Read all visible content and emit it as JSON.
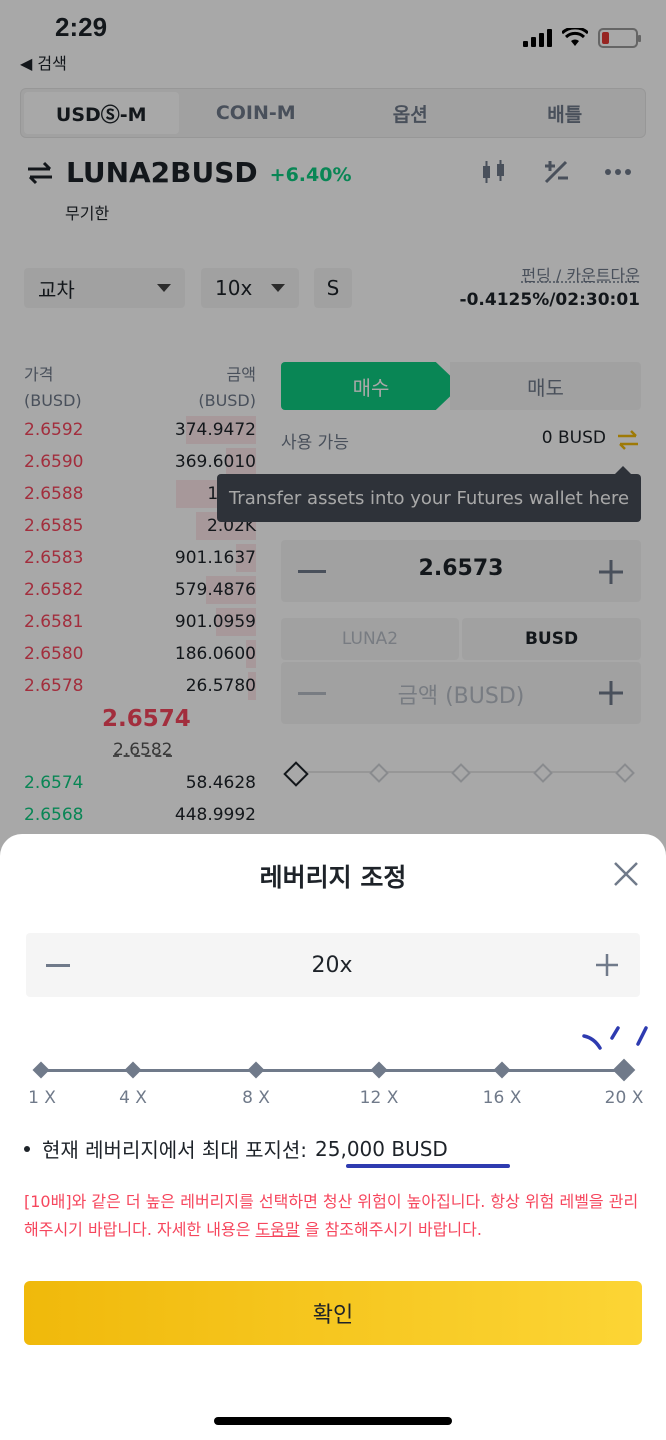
{
  "status_bar": {
    "time": "2:29",
    "back_label": "◀ 검색"
  },
  "tabs": [
    {
      "label": "USDⓈ-M",
      "active": true
    },
    {
      "label": "COIN-M"
    },
    {
      "label": "옵션"
    },
    {
      "label": "배틀"
    }
  ],
  "header": {
    "pair": "LUNA2BUSD",
    "change": "+6.40%",
    "subtitle": "무기한"
  },
  "controls": {
    "margin_mode": "교차",
    "leverage": "10x",
    "size_mode": "S",
    "funding_label": "펀딩 / 카운트다운",
    "funding_value": "-0.4125%/02:30:01"
  },
  "orderbook": {
    "price_header": "가격\n(BUSD)",
    "amount_header": "금액\n(BUSD)",
    "asks": [
      {
        "price": "2.6592",
        "amount": "374.9472"
      },
      {
        "price": "2.6590",
        "amount": "369.6010"
      },
      {
        "price": "2.6588",
        "amount": "122.3"
      },
      {
        "price": "2.6585",
        "amount": "2.02K"
      },
      {
        "price": "2.6583",
        "amount": "901.1637"
      },
      {
        "price": "2.6582",
        "amount": "579.4876"
      },
      {
        "price": "2.6581",
        "amount": "901.0959"
      },
      {
        "price": "2.6580",
        "amount": "186.0600"
      },
      {
        "price": "2.6578",
        "amount": "26.5780"
      }
    ],
    "mid_price": "2.6574",
    "mark_price": "2.6582",
    "bids": [
      {
        "price": "2.6574",
        "amount": "58.4628"
      },
      {
        "price": "2.6568",
        "amount": "448.9992"
      }
    ]
  },
  "order_form": {
    "buy_label": "매수",
    "sell_label": "매도",
    "available_label": "사용 가능",
    "available_value": "0 BUSD",
    "tooltip": "Transfer assets into your Futures wallet here",
    "price_value": "2.6573",
    "unit_luna": "LUNA2",
    "unit_busd": "BUSD",
    "amount_placeholder": "금액 (BUSD)"
  },
  "leverage_sheet": {
    "title": "레버리지 조정",
    "value": "20x",
    "ticks": [
      "1 X",
      "4 X",
      "8 X",
      "12 X",
      "16 X",
      "20 X"
    ],
    "selected_level": 20,
    "info_prefix": "현재 레버리지에서 최대 포지션:",
    "info_value": "25,000 BUSD",
    "warning_part1": "[10배]와 같은 더 높은 레버리지를 선택하면 청산 위험이 높아집니다. 항상 위험 레벨을 관리해주시기 바랍니다. 자세한 내용은 ",
    "warning_link": "도움말",
    "warning_part2": " 을 참조해주시기 바랍니다.",
    "confirm_label": "확인"
  },
  "colors": {
    "ask": "#f6465d",
    "bid": "#0ecb81",
    "brand": "#f0b90b"
  }
}
